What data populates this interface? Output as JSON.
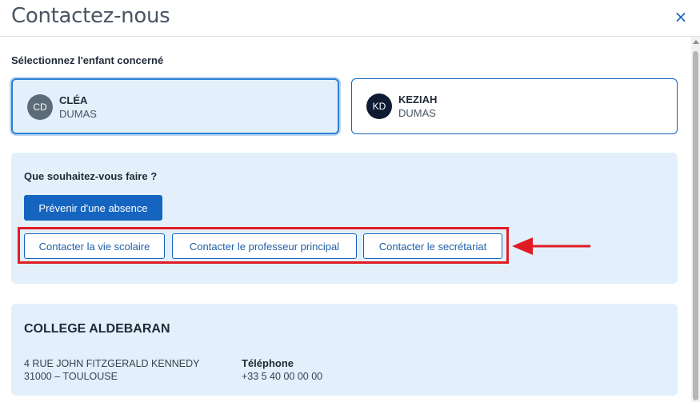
{
  "dialog": {
    "title": "Contactez-nous",
    "close_icon": "×"
  },
  "children_section": {
    "label": "Sélectionnez l'enfant concerné",
    "children": [
      {
        "initials": "CD",
        "firstname": "CLÉA",
        "lastname": "DUMAS",
        "selected": true,
        "avatar_color": "#5b6b78"
      },
      {
        "initials": "KD",
        "firstname": "KEZIAH",
        "lastname": "DUMAS",
        "selected": false,
        "avatar_color": "#0f1b33"
      }
    ]
  },
  "actions": {
    "title": "Que souhaitez-vous faire ?",
    "primary_button": "Prévenir d'une absence",
    "contact_buttons": [
      "Contacter la vie scolaire",
      "Contacter le professeur principal",
      "Contacter le secrétariat"
    ]
  },
  "school": {
    "name": "COLLEGE ALDEBARAN",
    "address_line1": "4 RUE JOHN FITZGERALD KENNEDY",
    "address_line2": "31000 – TOULOUSE",
    "phone_label": "Téléphone",
    "phone": "+33 5 40 00 00 00"
  },
  "colors": {
    "accent": "#1565c0",
    "panel": "#e3f0fb",
    "annotation": "#e01b24"
  }
}
